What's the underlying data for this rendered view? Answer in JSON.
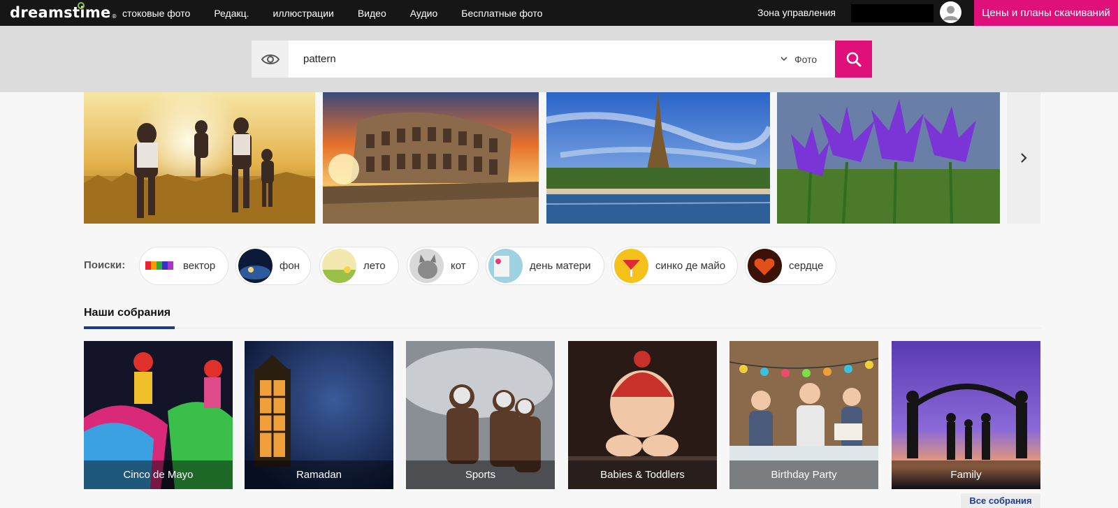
{
  "brand": {
    "logo": "dreamstime",
    "reg": "®"
  },
  "nav": {
    "items": [
      "стоковые фото",
      "Редакц.",
      "иллюстрации",
      "Видео",
      "Аудио",
      "Бесплатные фото"
    ],
    "zone": "Зона управления",
    "pricing": "Цены и планы скачиваний"
  },
  "search": {
    "query": "pattern",
    "type": "Фото",
    "eye_icon": "eye-icon",
    "search_icon": "search-icon"
  },
  "carousel": {
    "images": [
      "family-in-field",
      "colosseum-sunset",
      "eiffel-tower",
      "purple-crocus"
    ],
    "next_icon": "chevron-right-icon"
  },
  "searches": {
    "label": "Поиски:",
    "items": [
      "вектор",
      "фон",
      "лето",
      "кот",
      "день матери",
      "синко де майо",
      "сердце"
    ]
  },
  "collections": {
    "title": "Наши собрания",
    "items": [
      "Cinco de Mayo",
      "Ramadan",
      "Sports",
      "Babies & Toddlers",
      "Birthday Party",
      "Family"
    ],
    "all": "Все собрания"
  },
  "colors": {
    "accent": "#e0107a",
    "navbar": "#161616",
    "link": "#1c3b8c"
  }
}
